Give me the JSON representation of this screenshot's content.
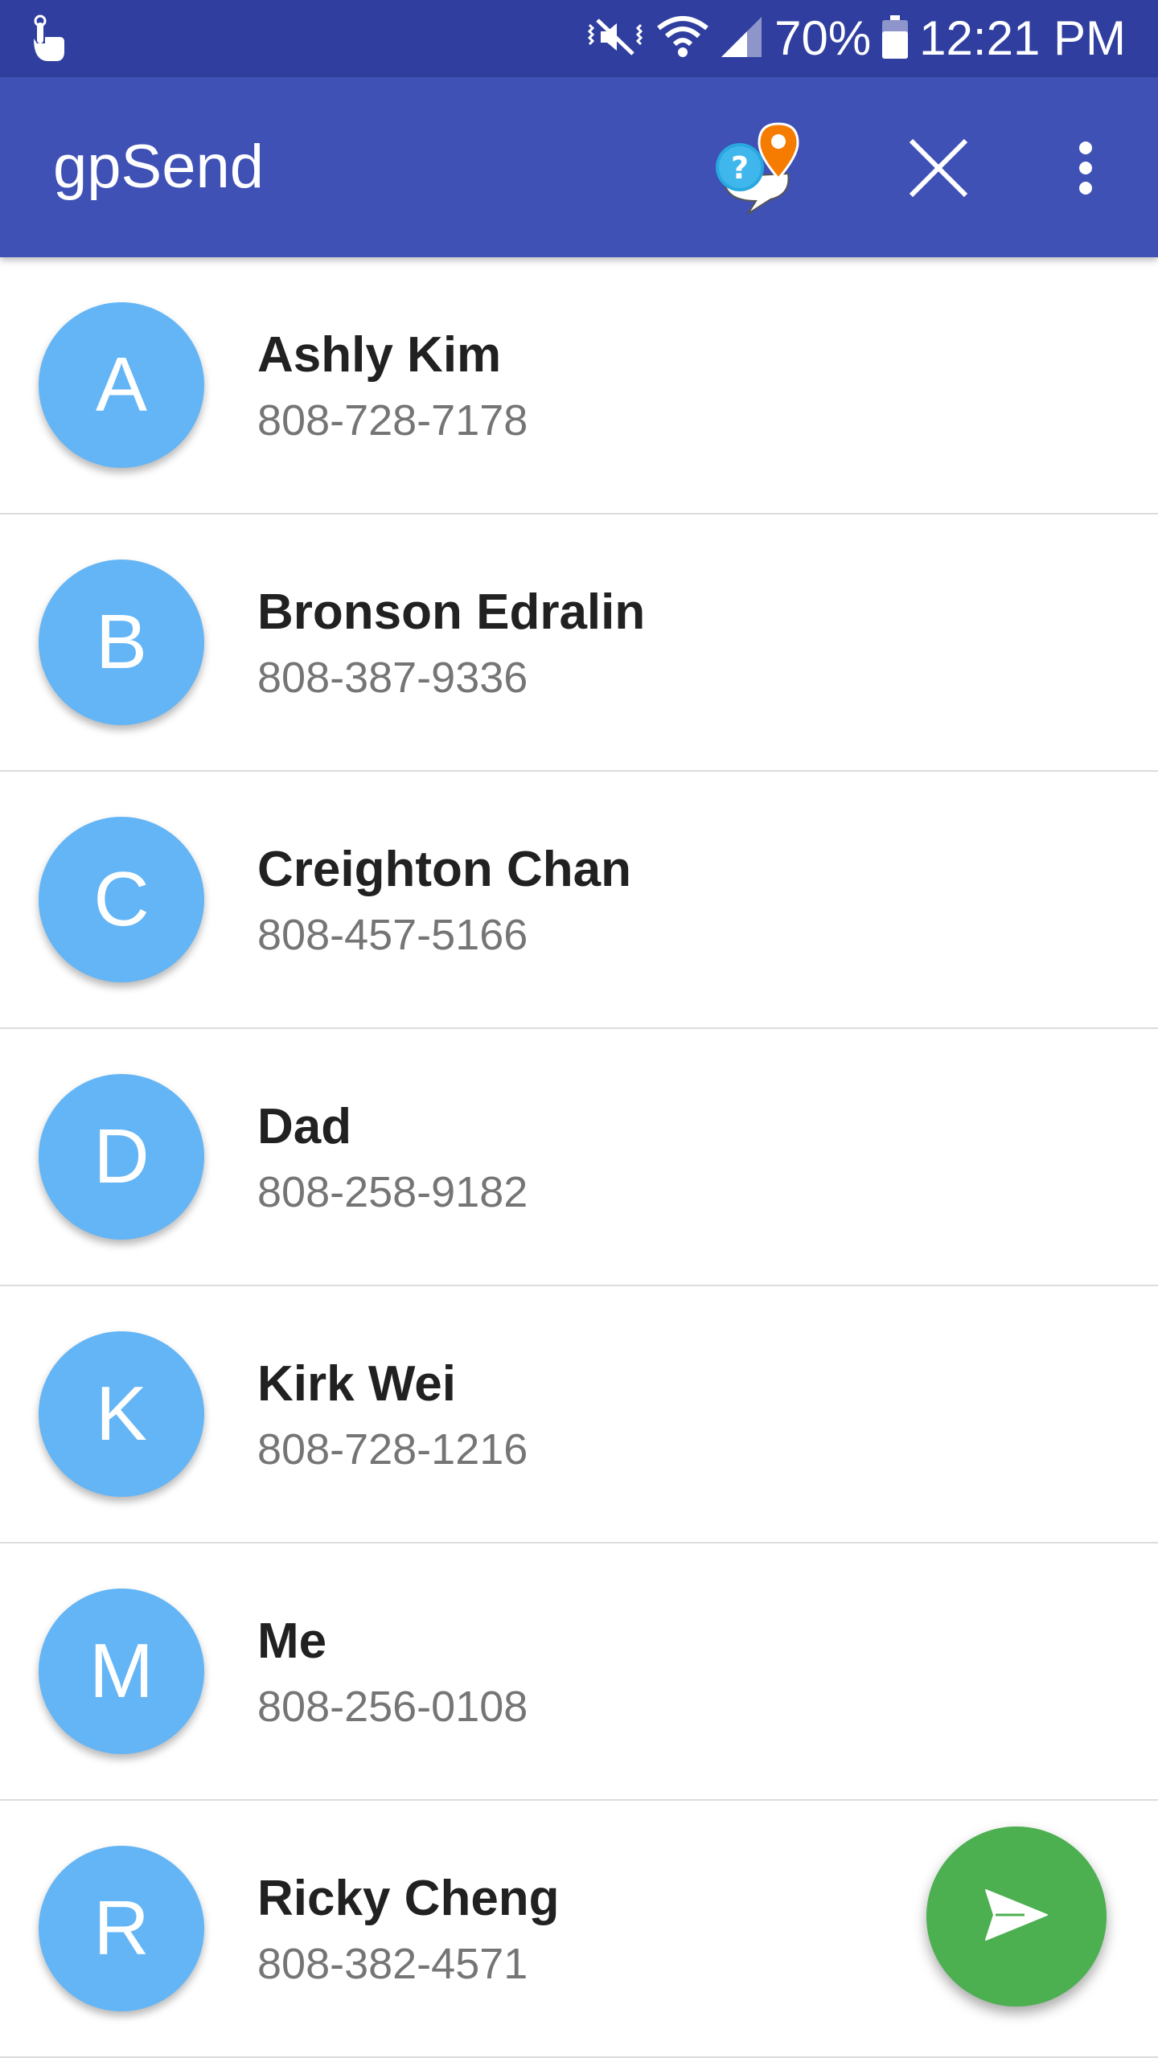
{
  "status_bar": {
    "battery": "70%",
    "time": "12:21 PM",
    "icons": [
      "touch-icon",
      "mute-vibrate-icon",
      "wifi-icon",
      "signal-icon",
      "battery-icon"
    ]
  },
  "app_bar": {
    "title": "gpSend",
    "logo_icon": "help-location-logo-icon",
    "actions": [
      "close-icon",
      "more-vert-icon"
    ]
  },
  "contacts": [
    {
      "initial": "A",
      "name": "Ashly Kim",
      "phone": "808-728-7178"
    },
    {
      "initial": "B",
      "name": "Bronson Edralin",
      "phone": "808-387-9336"
    },
    {
      "initial": "C",
      "name": "Creighton Chan",
      "phone": "808-457-5166"
    },
    {
      "initial": "D",
      "name": "Dad",
      "phone": "808-258-9182"
    },
    {
      "initial": "K",
      "name": "Kirk Wei",
      "phone": "808-728-1216"
    },
    {
      "initial": "M",
      "name": "Me",
      "phone": "808-256-0108"
    },
    {
      "initial": "R",
      "name": "Ricky Cheng",
      "phone": "808-382-4571"
    }
  ],
  "fab": {
    "icon": "send-icon"
  },
  "colors": {
    "status_bar": "#303f9f",
    "app_bar": "#3f51b5",
    "avatar": "#64b5f6",
    "fab": "#4caf50",
    "name_text": "#212121",
    "phone_text": "#757575"
  }
}
